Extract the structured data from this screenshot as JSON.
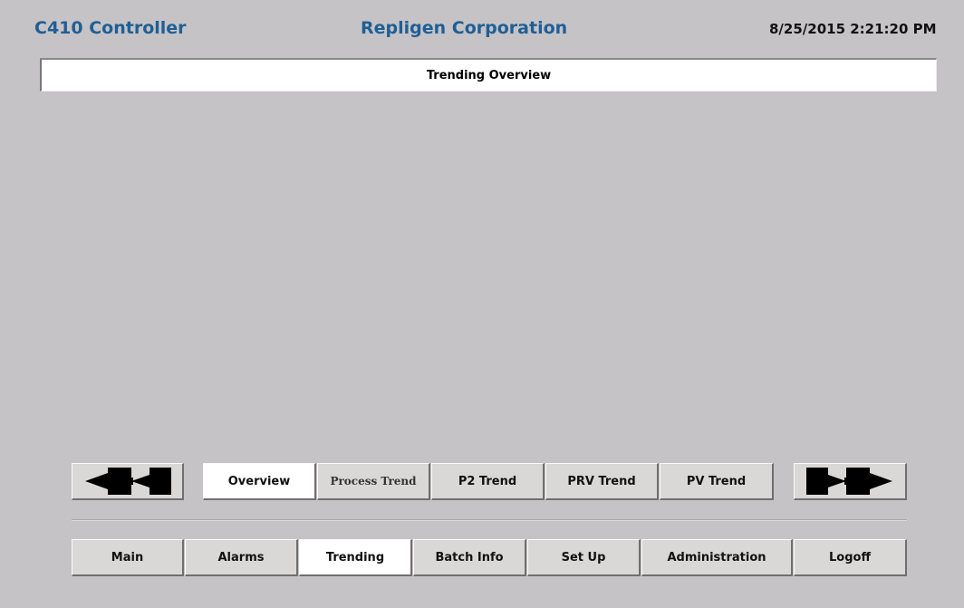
{
  "header": {
    "app_title": "C410 Controller",
    "company": "Repligen Corporation",
    "datetime": "8/25/2015 2:21:20 PM"
  },
  "page": {
    "title": "Trending Overview"
  },
  "trend_nav": {
    "prev_icon": "double-arrow-left-icon",
    "next_icon": "double-arrow-right-icon",
    "tabs": [
      {
        "label": "Overview",
        "active": true
      },
      {
        "label": "Process Trend",
        "active": false
      },
      {
        "label": "P2 Trend",
        "active": false
      },
      {
        "label": "PRV Trend",
        "active": false
      },
      {
        "label": "PV Trend",
        "active": false
      }
    ]
  },
  "main_nav": {
    "items": [
      {
        "label": "Main",
        "active": false
      },
      {
        "label": "Alarms",
        "active": false
      },
      {
        "label": "Trending",
        "active": true
      },
      {
        "label": "Batch Info",
        "active": false
      },
      {
        "label": "Set Up",
        "active": false
      },
      {
        "label": "Administration",
        "active": false
      },
      {
        "label": "Logoff",
        "active": false
      }
    ]
  },
  "colors": {
    "background": "#c6c3c6",
    "header_blue": "#1f5f96",
    "button_face": "#dad8d6",
    "button_active": "#ffffff"
  }
}
